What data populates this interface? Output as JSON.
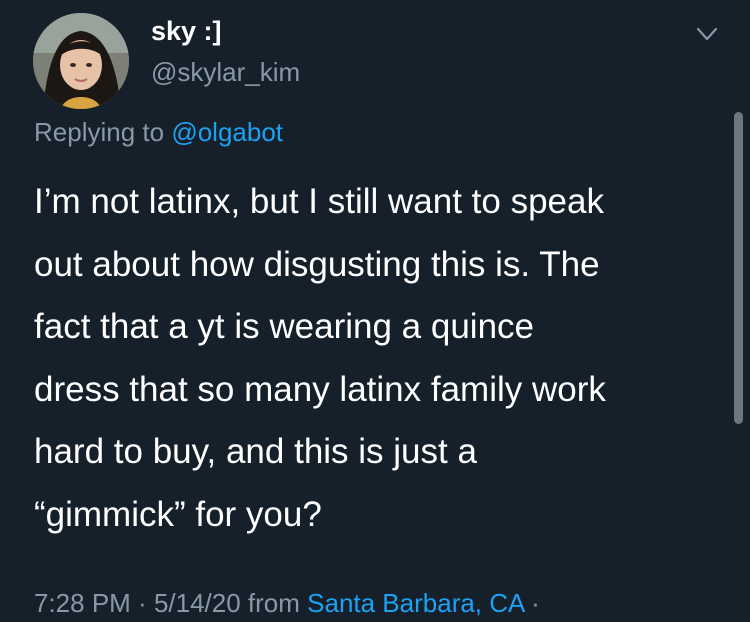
{
  "author": {
    "display_name": "sky :]",
    "handle": "@skylar_kim",
    "avatar_icon": "user-avatar-photo"
  },
  "reply": {
    "prefix": "Replying to",
    "mention": "@olgabot"
  },
  "body_lines": [
    "I’m not latinx, but I still want to speak",
    "out about how disgusting this is. The",
    "fact that a yt is wearing a quince",
    "dress that so many latinx family work",
    "hard to buy, and this is just a",
    "“gimmick” for you?"
  ],
  "meta": {
    "time": "7:28 PM",
    "sep1": " · ",
    "date": "5/14/20",
    "from": " from ",
    "location": "Santa Barbara, CA",
    "sep2": " ·"
  },
  "colors": {
    "background": "#15202b",
    "primary_text": "#ffffff",
    "secondary_text": "#8899a6",
    "link": "#1da1f2"
  },
  "icons": {
    "more": "chevron-down-icon"
  }
}
